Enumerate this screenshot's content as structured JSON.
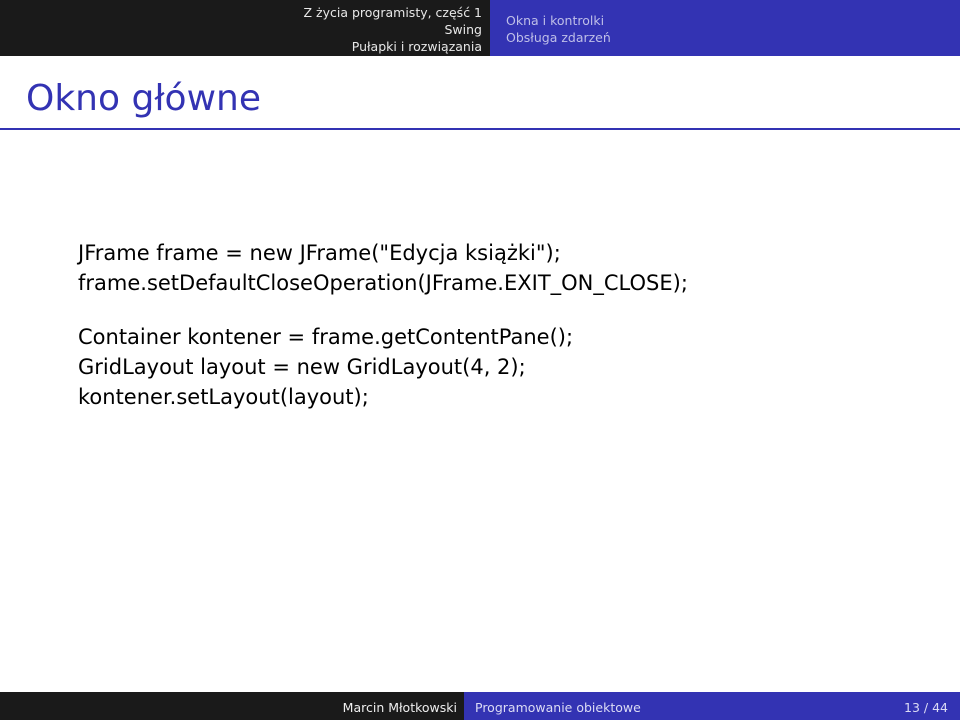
{
  "header": {
    "left_lines": [
      "Z życia programisty, część 1",
      "Swing",
      "Pułapki i rozwiązania"
    ],
    "right_lines": [
      "Okna i kontrolki",
      "Obsługa zdarzeń"
    ]
  },
  "title": "Okno główne",
  "code": {
    "line1": "JFrame frame = new JFrame(\"Edycja książki\");",
    "line2": "frame.setDefaultCloseOperation(JFrame.EXIT_ON_CLOSE);",
    "line3": "Container kontener = frame.getContentPane();",
    "line4": "GridLayout layout = new GridLayout(4, 2);",
    "line5": "kontener.setLayout(layout);"
  },
  "footer": {
    "author": "Marcin Młotkowski",
    "subject": "Programowanie obiektowe",
    "page": "13 / 44"
  }
}
